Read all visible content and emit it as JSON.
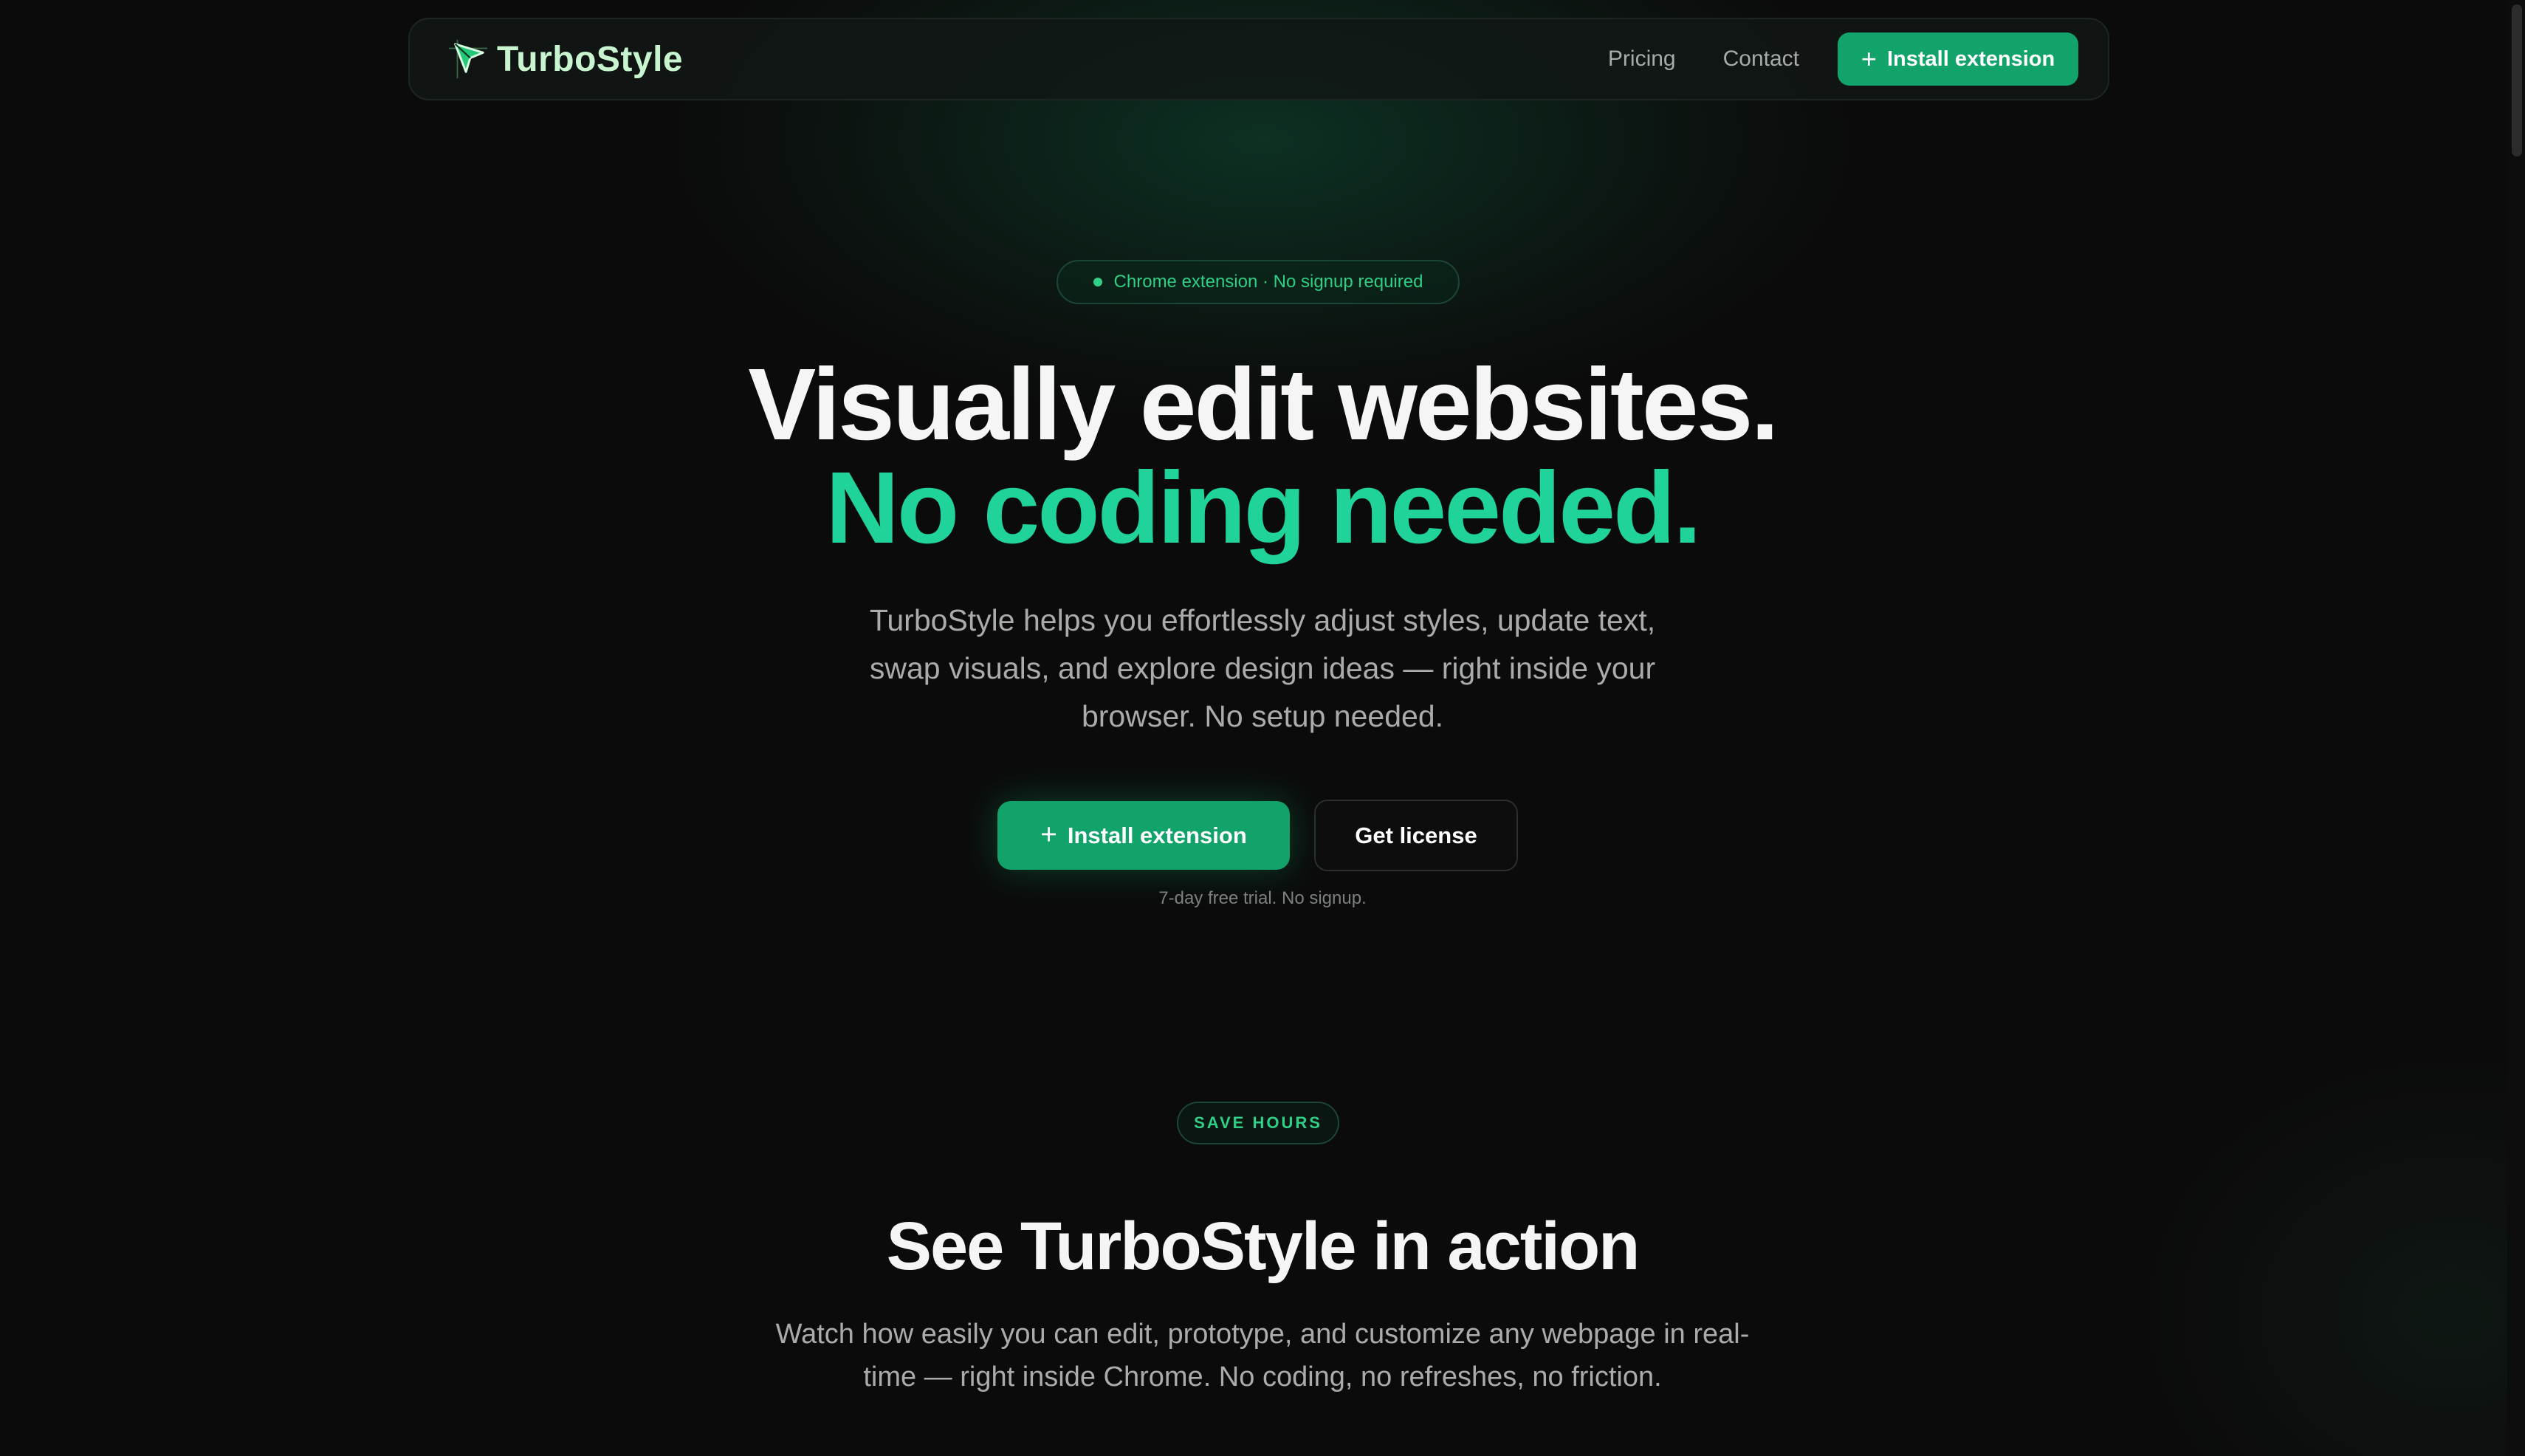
{
  "nav": {
    "brand": "TurboStyle",
    "links": [
      "Pricing",
      "Contact"
    ],
    "install_label": "Install extension"
  },
  "hero": {
    "badge": "Chrome extension · No signup required",
    "title_line1": "Visually edit websites.",
    "title_line2": "No coding needed.",
    "description": "TurboStyle helps you effortlessly adjust styles, update text, swap visuals, and explore design ideas — right inside your browser. No setup needed.",
    "install_label": "Install extension",
    "license_label": "Get license",
    "note": "7-day free trial. No signup."
  },
  "section": {
    "badge": "SAVE HOURS",
    "title": "See TurboStyle in action",
    "description": "Watch how easily you can edit, prototype, and customize any webpage in real-time — right inside Chrome. No coding, no refreshes, no friction."
  },
  "icons": {
    "plus": "+",
    "logo": "cursor-arrow-logo-icon"
  },
  "colors": {
    "background": "#0b0b0b",
    "accent": "#12a36a",
    "accent_text": "#1fd39a",
    "brand_text": "#c8f5d0"
  }
}
